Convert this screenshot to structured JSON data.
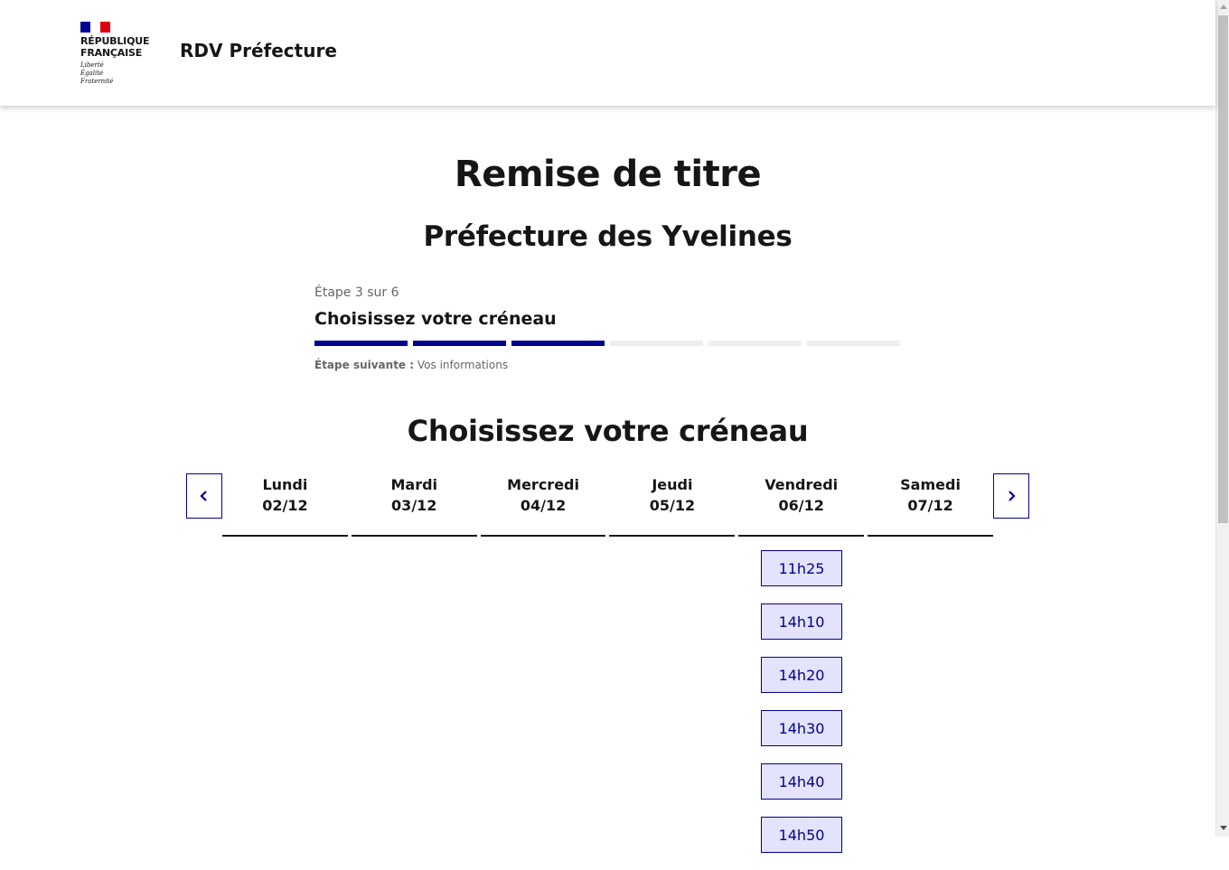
{
  "header": {
    "logo_text": "RÉPUBLIQUE\nFRANÇAISE",
    "motto": "Liberté\nÉgalité\nFraternité",
    "service_title": "RDV Préfecture",
    "flag_colors": [
      "#000091",
      "#ffffff",
      "#e1000f"
    ]
  },
  "page": {
    "title": "Remise de titre",
    "subtitle": "Préfecture des Yvelines"
  },
  "stepper": {
    "state": "Étape 3 sur 6",
    "current_title": "Choisissez votre créneau",
    "current_step": 3,
    "total_steps": 6,
    "next_label": "Étape suivante :",
    "next_value": "Vos informations"
  },
  "calendar": {
    "section_title": "Choisissez votre créneau",
    "prev_icon": "chevron-left-icon",
    "next_icon": "chevron-right-icon",
    "days": [
      {
        "name": "Lundi",
        "date": "02/12"
      },
      {
        "name": "Mardi",
        "date": "03/12"
      },
      {
        "name": "Mercredi",
        "date": "04/12"
      },
      {
        "name": "Jeudi",
        "date": "05/12"
      },
      {
        "name": "Vendredi",
        "date": "06/12"
      },
      {
        "name": "Samedi",
        "date": "07/12"
      }
    ],
    "slots_day": "Vendredi",
    "slots": [
      "11h25",
      "14h10",
      "14h20",
      "14h30",
      "14h40",
      "14h50"
    ]
  },
  "colors": {
    "accent": "#000091",
    "slot_bg": "#e3e3fd",
    "step_inactive": "#eeeeee"
  }
}
